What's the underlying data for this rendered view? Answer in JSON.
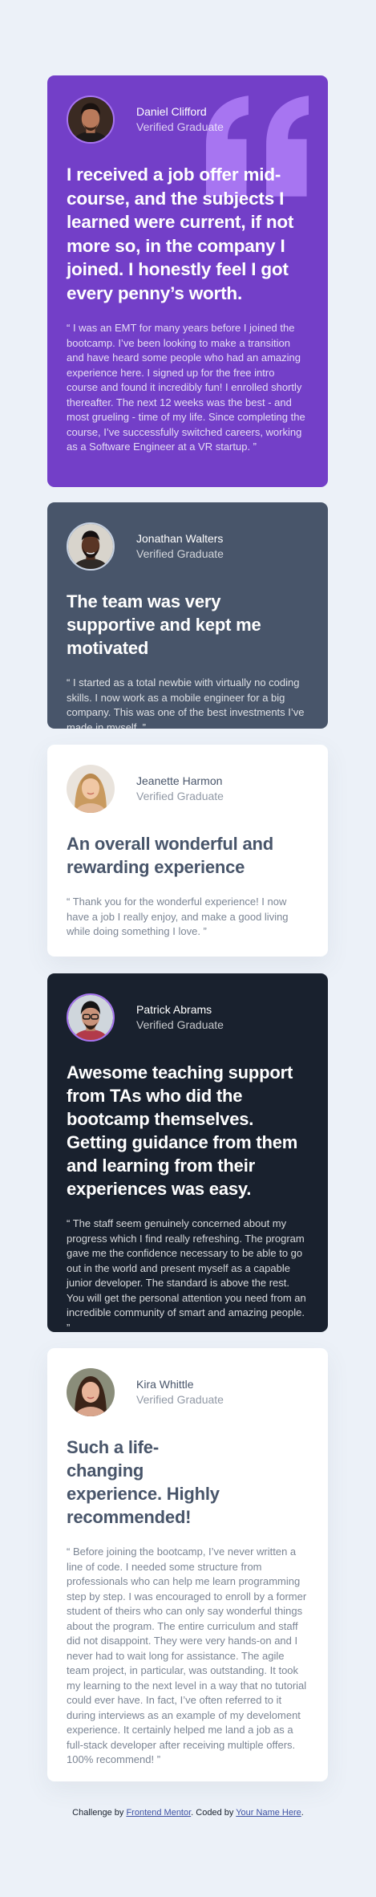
{
  "testimonials": [
    {
      "name": "Daniel Clifford",
      "role": "Verified Graduate",
      "headline": "I received a job offer mid-course, and the subjects I learned were current, if not more so, in the company I joined. I honestly feel I got every penny’s worth.",
      "body": "“ I was an EMT for many years before I joined the bootcamp. I’ve been looking to make a transition and have heard some people who had an amazing experience here. I signed up for the free intro course and found it incredibly fun! I enrolled shortly thereafter. The next 12 weeks was the best - and most grueling - time of my life. Since completing the course, I’ve successfully switched careers, working as a Software Engineer at a VR startup. ”"
    },
    {
      "name": "Jonathan Walters",
      "role": "Verified Graduate",
      "headline": "The team was very supportive and kept me motivated",
      "body": "“ I started as a total newbie with virtually no coding skills. I now work as a mobile engineer for a big company. This was one of the best investments I’ve made in myself. ”"
    },
    {
      "name": "Jeanette Harmon",
      "role": "Verified Graduate",
      "headline": "An overall wonderful and rewarding experience",
      "body": "“ Thank you for the wonderful experience! I now have a job I really enjoy, and make a good living while doing something I love. ”"
    },
    {
      "name": "Patrick Abrams",
      "role": "Verified Graduate",
      "headline": "Awesome teaching support from TAs who did the bootcamp themselves. Getting guidance from them and learning from their experiences was easy.",
      "body": "“ The staff seem genuinely concerned about my progress which I find really refreshing. The program gave me the confidence necessary to be able to go out in the world and present myself as a capable junior developer. The standard is above the rest. You will get the personal attention you need from an incredible community of smart and amazing people. ”"
    },
    {
      "name": "Kira Whittle",
      "role": "Verified Graduate",
      "headline": "Such a life-changing experience. Highly recommended!",
      "body": "“ Before joining the bootcamp, I’ve never written a line of code. I needed some structure from professionals who can help me learn programming step by step. I was encouraged to enroll by a former student of theirs who can only say wonderful things about the program. The entire curriculum and staff did not disappoint. They were very hands-on and I never had to wait long for assistance. The agile team project, in particular, was outstanding. It took my learning to the next level in a way that no tutorial could ever have. In fact, I’ve often referred to it during interviews as an example of my develoment experience. It certainly helped me land a job as a full-stack developer after receiving multiple offers. 100% recommend! ”"
    }
  ],
  "attribution": {
    "prefix": "Challenge by ",
    "link1": "Frontend Mentor",
    "middle": ". Coded by ",
    "link2": "Your Name Here",
    "suffix": "."
  },
  "colors": {
    "purple": "#733fc8",
    "grey_blue": "#48556a",
    "white": "#ffffff",
    "dark": "#19212e",
    "background": "#ecf1f8",
    "quote_mark": "#a775f1"
  },
  "icons": {
    "quote": "quotation-mark-icon",
    "avatars": [
      "avatar-daniel",
      "avatar-jonathan",
      "avatar-jeanette",
      "avatar-patrick",
      "avatar-kira"
    ]
  }
}
